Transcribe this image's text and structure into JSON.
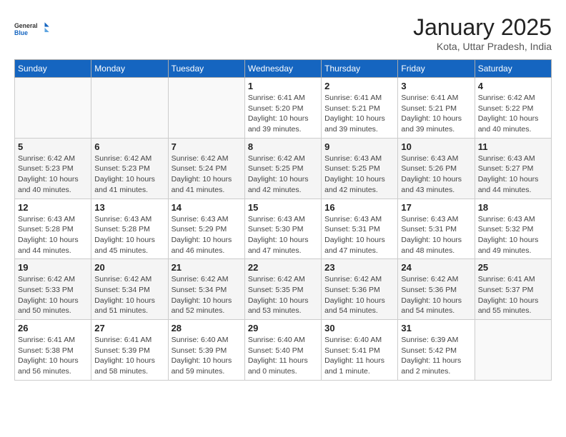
{
  "header": {
    "logo_line1": "General",
    "logo_line2": "Blue",
    "month": "January 2025",
    "location": "Kota, Uttar Pradesh, India"
  },
  "days_of_week": [
    "Sunday",
    "Monday",
    "Tuesday",
    "Wednesday",
    "Thursday",
    "Friday",
    "Saturday"
  ],
  "weeks": [
    [
      {
        "day": "",
        "info": ""
      },
      {
        "day": "",
        "info": ""
      },
      {
        "day": "",
        "info": ""
      },
      {
        "day": "1",
        "info": "Sunrise: 6:41 AM\nSunset: 5:20 PM\nDaylight: 10 hours\nand 39 minutes."
      },
      {
        "day": "2",
        "info": "Sunrise: 6:41 AM\nSunset: 5:21 PM\nDaylight: 10 hours\nand 39 minutes."
      },
      {
        "day": "3",
        "info": "Sunrise: 6:41 AM\nSunset: 5:21 PM\nDaylight: 10 hours\nand 39 minutes."
      },
      {
        "day": "4",
        "info": "Sunrise: 6:42 AM\nSunset: 5:22 PM\nDaylight: 10 hours\nand 40 minutes."
      }
    ],
    [
      {
        "day": "5",
        "info": "Sunrise: 6:42 AM\nSunset: 5:23 PM\nDaylight: 10 hours\nand 40 minutes."
      },
      {
        "day": "6",
        "info": "Sunrise: 6:42 AM\nSunset: 5:23 PM\nDaylight: 10 hours\nand 41 minutes."
      },
      {
        "day": "7",
        "info": "Sunrise: 6:42 AM\nSunset: 5:24 PM\nDaylight: 10 hours\nand 41 minutes."
      },
      {
        "day": "8",
        "info": "Sunrise: 6:42 AM\nSunset: 5:25 PM\nDaylight: 10 hours\nand 42 minutes."
      },
      {
        "day": "9",
        "info": "Sunrise: 6:43 AM\nSunset: 5:25 PM\nDaylight: 10 hours\nand 42 minutes."
      },
      {
        "day": "10",
        "info": "Sunrise: 6:43 AM\nSunset: 5:26 PM\nDaylight: 10 hours\nand 43 minutes."
      },
      {
        "day": "11",
        "info": "Sunrise: 6:43 AM\nSunset: 5:27 PM\nDaylight: 10 hours\nand 44 minutes."
      }
    ],
    [
      {
        "day": "12",
        "info": "Sunrise: 6:43 AM\nSunset: 5:28 PM\nDaylight: 10 hours\nand 44 minutes."
      },
      {
        "day": "13",
        "info": "Sunrise: 6:43 AM\nSunset: 5:28 PM\nDaylight: 10 hours\nand 45 minutes."
      },
      {
        "day": "14",
        "info": "Sunrise: 6:43 AM\nSunset: 5:29 PM\nDaylight: 10 hours\nand 46 minutes."
      },
      {
        "day": "15",
        "info": "Sunrise: 6:43 AM\nSunset: 5:30 PM\nDaylight: 10 hours\nand 47 minutes."
      },
      {
        "day": "16",
        "info": "Sunrise: 6:43 AM\nSunset: 5:31 PM\nDaylight: 10 hours\nand 47 minutes."
      },
      {
        "day": "17",
        "info": "Sunrise: 6:43 AM\nSunset: 5:31 PM\nDaylight: 10 hours\nand 48 minutes."
      },
      {
        "day": "18",
        "info": "Sunrise: 6:43 AM\nSunset: 5:32 PM\nDaylight: 10 hours\nand 49 minutes."
      }
    ],
    [
      {
        "day": "19",
        "info": "Sunrise: 6:42 AM\nSunset: 5:33 PM\nDaylight: 10 hours\nand 50 minutes."
      },
      {
        "day": "20",
        "info": "Sunrise: 6:42 AM\nSunset: 5:34 PM\nDaylight: 10 hours\nand 51 minutes."
      },
      {
        "day": "21",
        "info": "Sunrise: 6:42 AM\nSunset: 5:34 PM\nDaylight: 10 hours\nand 52 minutes."
      },
      {
        "day": "22",
        "info": "Sunrise: 6:42 AM\nSunset: 5:35 PM\nDaylight: 10 hours\nand 53 minutes."
      },
      {
        "day": "23",
        "info": "Sunrise: 6:42 AM\nSunset: 5:36 PM\nDaylight: 10 hours\nand 54 minutes."
      },
      {
        "day": "24",
        "info": "Sunrise: 6:42 AM\nSunset: 5:36 PM\nDaylight: 10 hours\nand 54 minutes."
      },
      {
        "day": "25",
        "info": "Sunrise: 6:41 AM\nSunset: 5:37 PM\nDaylight: 10 hours\nand 55 minutes."
      }
    ],
    [
      {
        "day": "26",
        "info": "Sunrise: 6:41 AM\nSunset: 5:38 PM\nDaylight: 10 hours\nand 56 minutes."
      },
      {
        "day": "27",
        "info": "Sunrise: 6:41 AM\nSunset: 5:39 PM\nDaylight: 10 hours\nand 58 minutes."
      },
      {
        "day": "28",
        "info": "Sunrise: 6:40 AM\nSunset: 5:39 PM\nDaylight: 10 hours\nand 59 minutes."
      },
      {
        "day": "29",
        "info": "Sunrise: 6:40 AM\nSunset: 5:40 PM\nDaylight: 11 hours\nand 0 minutes."
      },
      {
        "day": "30",
        "info": "Sunrise: 6:40 AM\nSunset: 5:41 PM\nDaylight: 11 hours\nand 1 minute."
      },
      {
        "day": "31",
        "info": "Sunrise: 6:39 AM\nSunset: 5:42 PM\nDaylight: 11 hours\nand 2 minutes."
      },
      {
        "day": "",
        "info": ""
      }
    ]
  ]
}
